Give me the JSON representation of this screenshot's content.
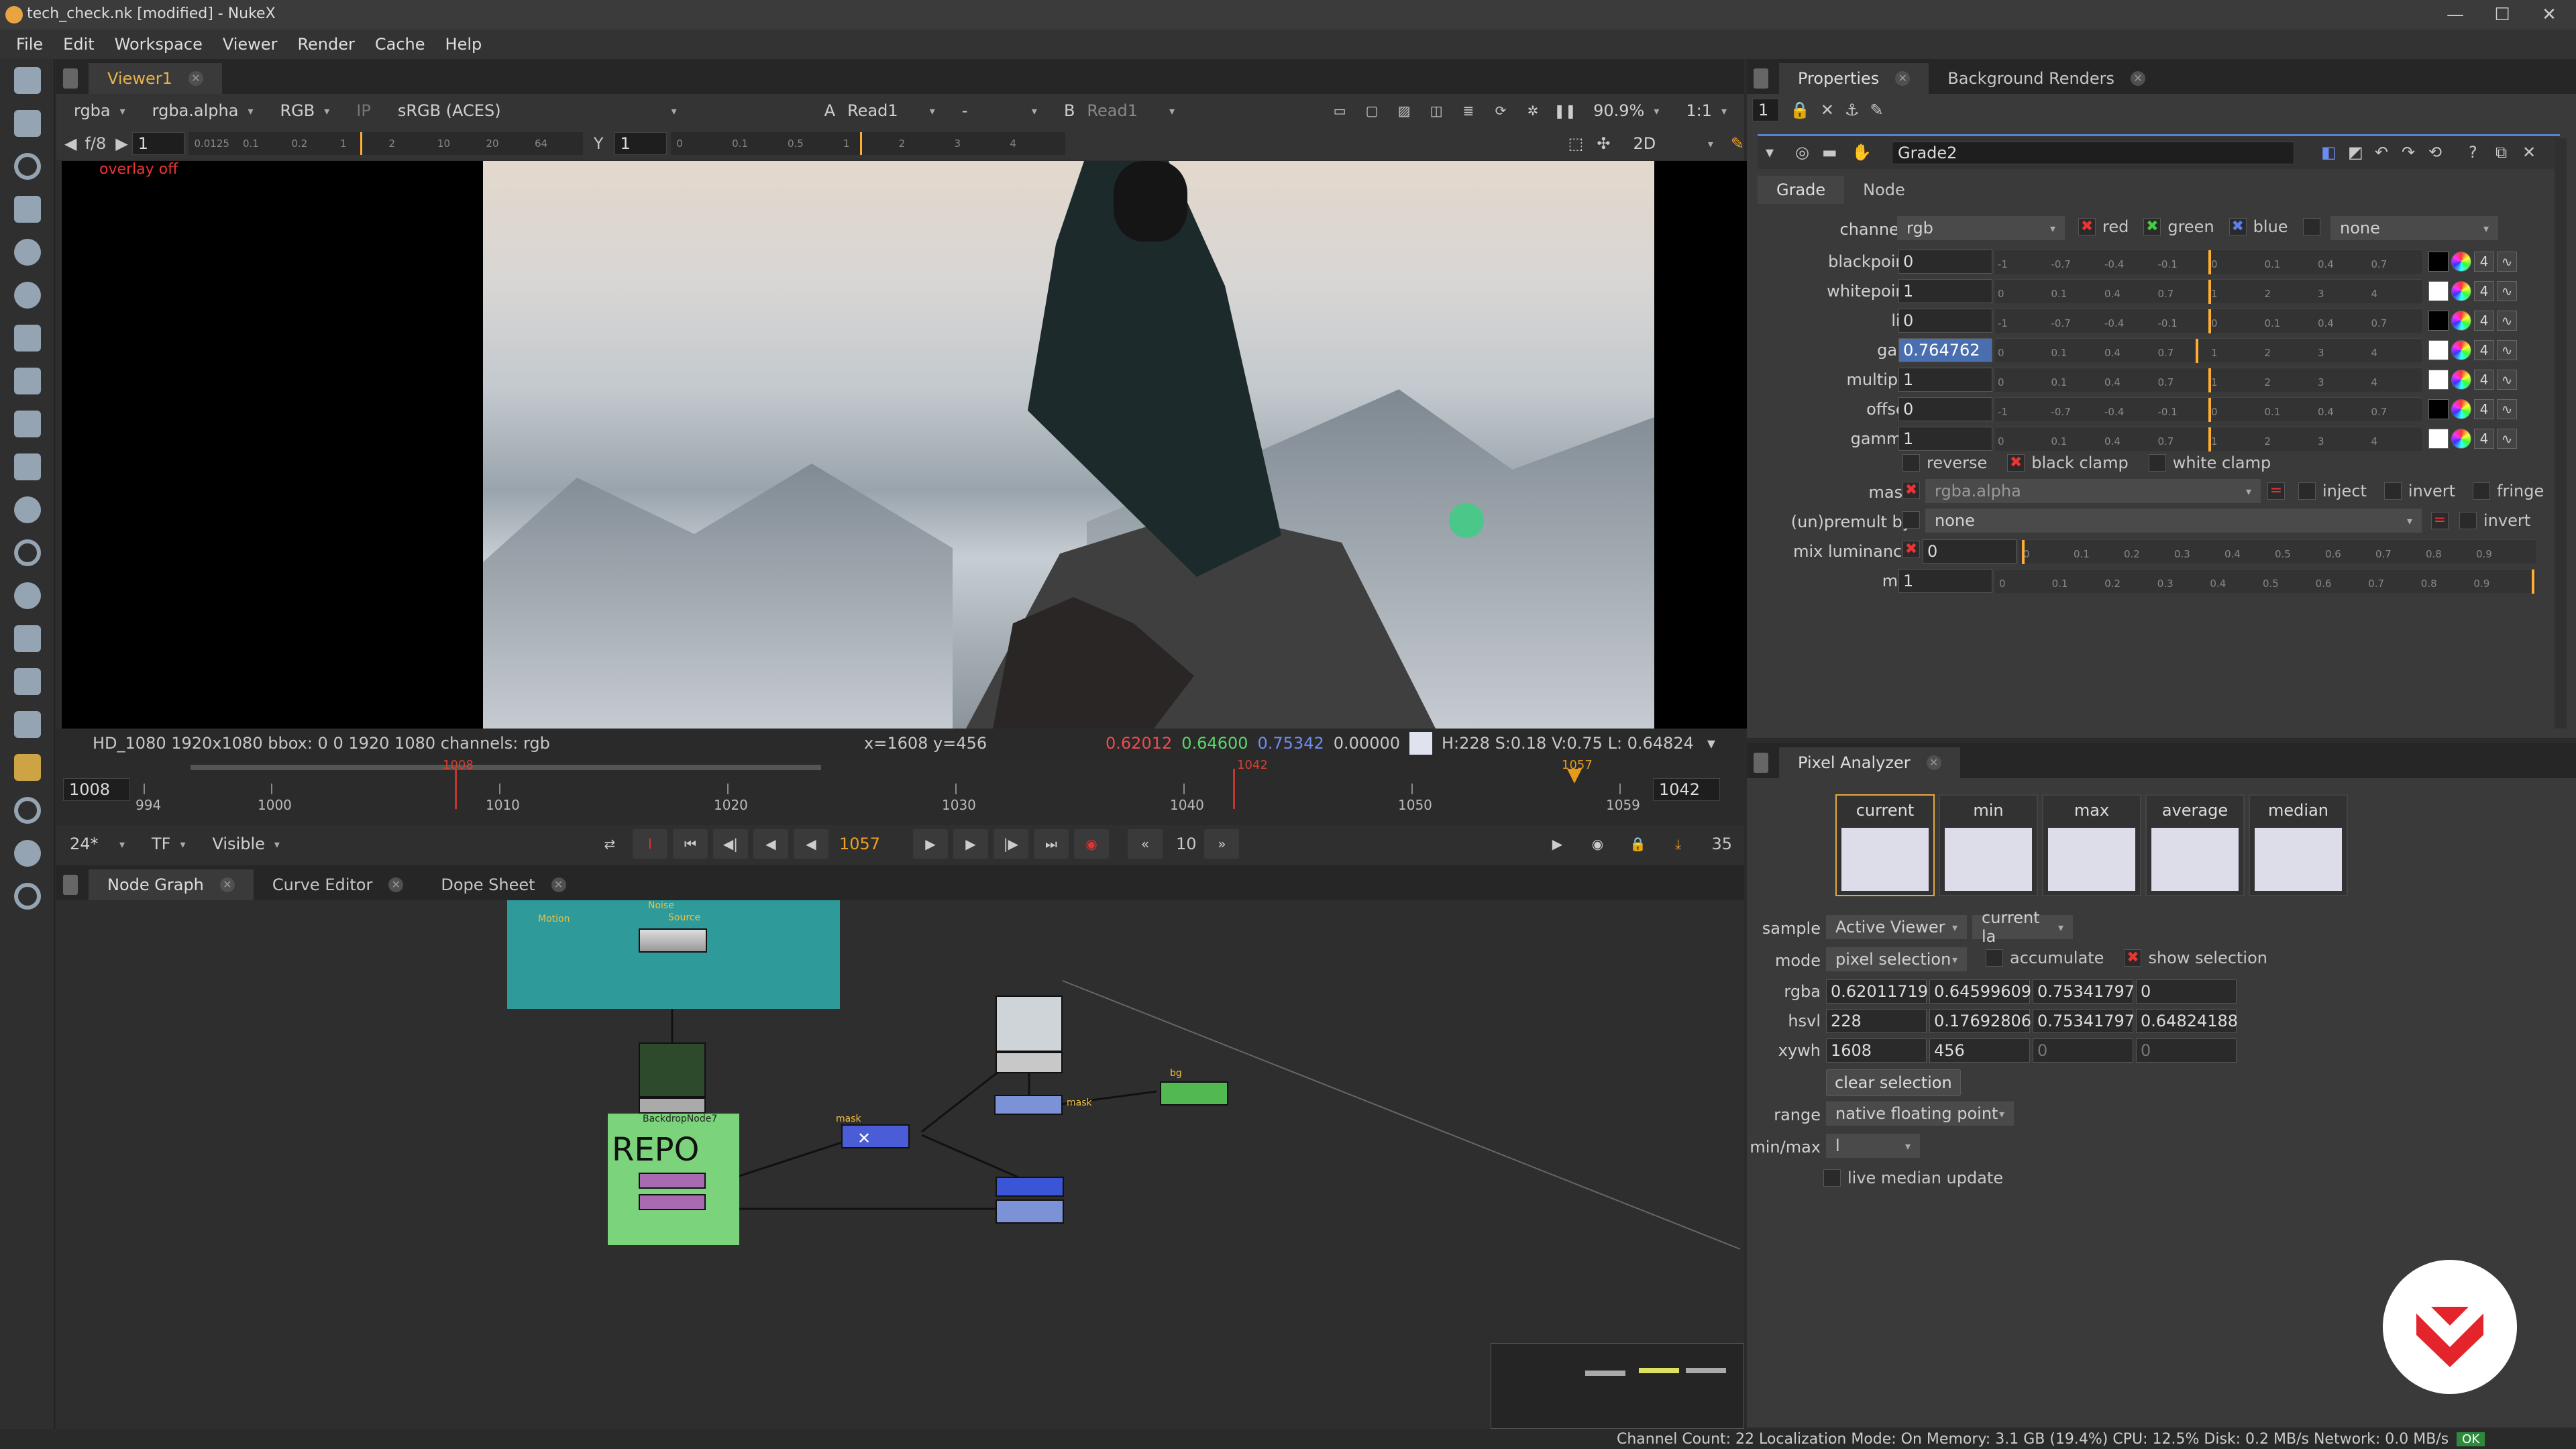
{
  "window": {
    "title": "tech_check.nk [modified] - NukeX",
    "min": "—",
    "max": "☐",
    "close": "✕"
  },
  "menu": [
    "File",
    "Edit",
    "Workspace",
    "Viewer",
    "Render",
    "Cache",
    "Help"
  ],
  "toolbar_icons": [
    "image-icon",
    "paint-icon",
    "time-icon",
    "channel-icon",
    "color-icon",
    "filter-icon",
    "keyer-icon",
    "merge-icon",
    "transform-icon",
    "3d-icon",
    "particles-icon",
    "deep-icon",
    "views-icon",
    "metadata-icon",
    "toolsets-icon",
    "other-icon",
    "furnace-icon",
    "ocula-icon",
    "cara-icon",
    "nukex-icon"
  ],
  "viewer": {
    "tab": "Viewer1",
    "channels": "rgba",
    "alpha": "rgba.alpha",
    "display": "RGB",
    "ip": "IP",
    "lut": "sRGB (ACES)",
    "a_label": "A",
    "a_input": "Read1",
    "op": "-",
    "b_label": "B",
    "b_input": "Read1",
    "zoom": "90.9%",
    "ratio": "1:1",
    "fstop_label": "f/8",
    "fstop_value": "1",
    "y_label": "Y",
    "y_value": "1",
    "mode2d": "2D",
    "gain_ticks": [
      "0.0125",
      "0.1",
      "0.2",
      "1",
      "2",
      "10",
      "20",
      "64"
    ],
    "gamma_ticks": [
      "0",
      "0.1",
      "0.5",
      "1",
      "2",
      "3",
      "4"
    ],
    "overlay": "overlay off",
    "info_left": "HD_1080 1920x1080  bbox: 0 0 1920 1080 channels: rgb",
    "info_pos": "x=1608 y=456",
    "info_r": "0.62012",
    "info_g": "0.64600",
    "info_b": "0.75342",
    "info_a": "0.00000",
    "info_hsv": "H:228 S:0.18 V:0.75  L: 0.64824"
  },
  "timeline": {
    "start": "1008",
    "end": "1042",
    "in_marker": "1008",
    "out_marker": "1042",
    "cur_marker": "1057",
    "ticks": [
      "994",
      "1000",
      "1010",
      "1020",
      "1030",
      "1040",
      "1050",
      "1059"
    ],
    "fps": "24*",
    "tf": "TF",
    "visible": "Visible",
    "current_frame": "1057",
    "increment": "10",
    "right_count": "35"
  },
  "nodegraph": {
    "tabs": [
      "Node Graph",
      "Curve Editor",
      "Dope Sheet"
    ],
    "backdrop_top_label": "Motion",
    "backdrop_name": "BackdropNode7",
    "backdrop_text": "REPO",
    "mask_label1": "mask",
    "mask_label2": "mask",
    "bg_label": "bg",
    "node_top_label": "Noise",
    "node_source": "Source"
  },
  "properties": {
    "tabs": [
      "Properties",
      "Background Renders"
    ],
    "count": "1",
    "node_name": "Grade2",
    "subtabs": [
      "Grade",
      "Node"
    ],
    "channels_label": "channels",
    "channels_value": "rgb",
    "red": "red",
    "green": "green",
    "blue": "blue",
    "none": "none",
    "knobs": [
      {
        "label": "blackpoint",
        "value": "0"
      },
      {
        "label": "whitepoint",
        "value": "1"
      },
      {
        "label": "lift",
        "value": "0"
      },
      {
        "label": "gain",
        "value": "0.764762"
      },
      {
        "label": "multiply",
        "value": "1"
      },
      {
        "label": "offset",
        "value": "0"
      },
      {
        "label": "gamma",
        "value": "1"
      }
    ],
    "reverse": "reverse",
    "black_clamp": "black clamp",
    "white_clamp": "white clamp",
    "mask_label": "mask",
    "mask_value": "rgba.alpha",
    "inject": "inject",
    "invert": "invert",
    "fringe": "fringe",
    "premult_label": "(un)premult by",
    "premult_value": "none",
    "premult_invert": "invert",
    "mixlum_label": "mix luminance",
    "mixlum_value": "0",
    "mix_label": "mix",
    "mix_value": "1",
    "slider_nums_a": [
      "-1",
      "-0.7",
      "-0.4",
      "-0.1",
      "0",
      "0.1",
      "0.4",
      "0.7"
    ],
    "slider_nums_b": [
      "0",
      "0.1",
      "0.4",
      "0.7",
      "1",
      "2",
      "3",
      "4"
    ],
    "slider_nums_c": [
      "0",
      "0.1",
      "0.2",
      "0.3",
      "0.4",
      "0.5",
      "0.6",
      "0.7",
      "0.8",
      "0.9"
    ],
    "swatch_count": "4"
  },
  "pixel_analyzer": {
    "tab": "Pixel Analyzer",
    "columns": [
      "current",
      "min",
      "max",
      "average",
      "median"
    ],
    "sample_label": "sample",
    "sample_value": "Active Viewer",
    "sample_layer": "current la",
    "mode_label": "mode",
    "mode_value": "pixel selection",
    "accumulate": "accumulate",
    "show_selection": "show selection",
    "rgba_label": "rgba",
    "rgba": [
      "0.62011719",
      "0.64599609",
      "0.75341797",
      "0"
    ],
    "hsvl_label": "hsvl",
    "hsvl": [
      "228",
      "0.17692806",
      "0.75341797",
      "0.64824188"
    ],
    "xywh_label": "xywh",
    "xywh": [
      "1608",
      "456",
      "0",
      "0"
    ],
    "clear": "clear selection",
    "range_label": "range",
    "range_value": "native floating point",
    "minmax_label": "min/max",
    "minmax_value": "l",
    "live_median": "live median update"
  },
  "status": "Channel Count: 22  Localization Mode: On  Memory: 3.1 GB (19.4%)  CPU: 12.5%  Disk: 0.2 MB/s  Network: 0.0 MB/s",
  "status_ok": "OK"
}
